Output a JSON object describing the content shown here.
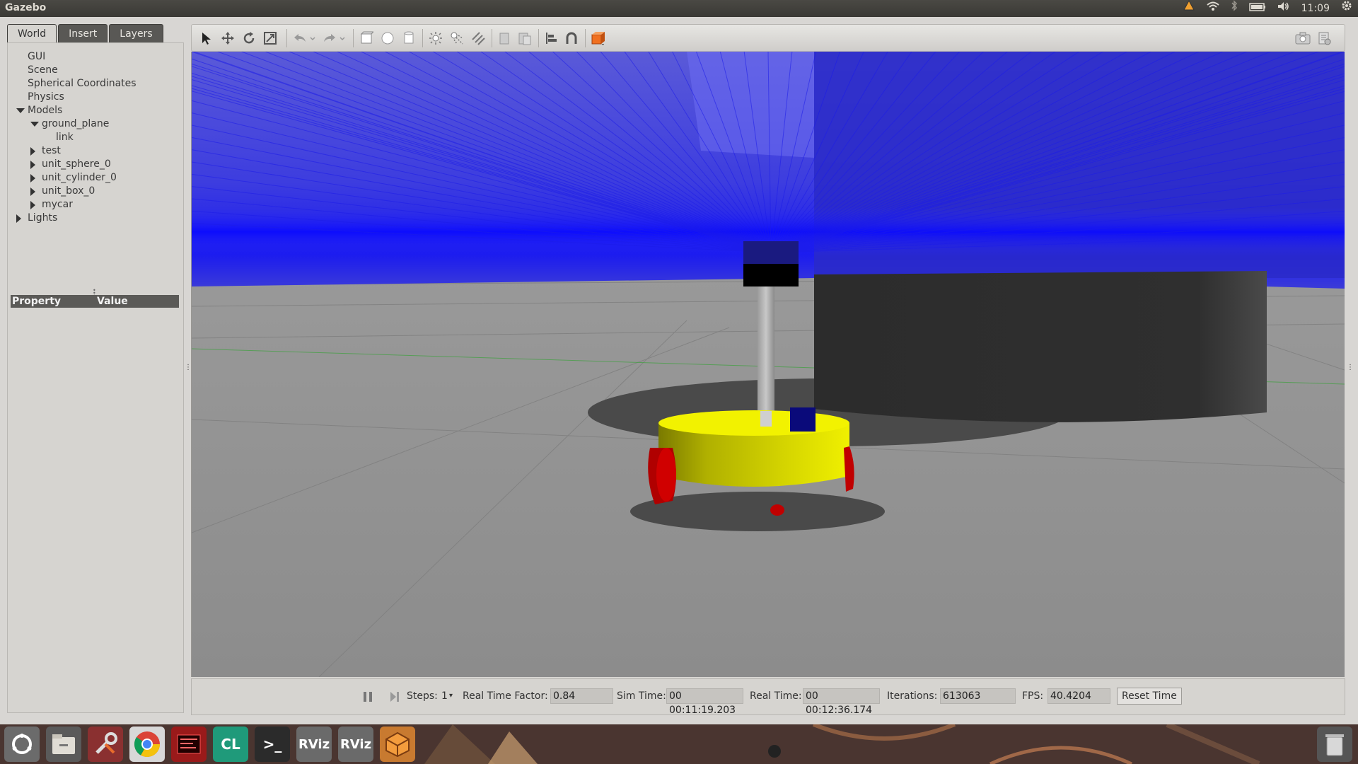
{
  "topbar": {
    "app_title": "Gazebo",
    "clock": "11:09",
    "icons": [
      "ubuntu-one-icon",
      "wifi-icon",
      "bluetooth-icon",
      "battery-icon",
      "volume-icon",
      "power-gear-icon"
    ]
  },
  "left_panel": {
    "tabs": [
      {
        "label": "World",
        "active": true
      },
      {
        "label": "Insert",
        "active": false
      },
      {
        "label": "Layers",
        "active": false
      }
    ],
    "tree": [
      {
        "label": "GUI",
        "level": 1,
        "expander": "none"
      },
      {
        "label": "Scene",
        "level": 1,
        "expander": "none"
      },
      {
        "label": "Spherical Coordinates",
        "level": 1,
        "expander": "none"
      },
      {
        "label": "Physics",
        "level": 1,
        "expander": "none"
      },
      {
        "label": "Models",
        "level": 1,
        "expander": "expanded"
      },
      {
        "label": "ground_plane",
        "level": 2,
        "expander": "expanded"
      },
      {
        "label": "link",
        "level": 3,
        "expander": "none"
      },
      {
        "label": "test",
        "level": 2,
        "expander": "collapsed"
      },
      {
        "label": "unit_sphere_0",
        "level": 2,
        "expander": "collapsed"
      },
      {
        "label": "unit_cylinder_0",
        "level": 2,
        "expander": "collapsed"
      },
      {
        "label": "unit_box_0",
        "level": 2,
        "expander": "collapsed"
      },
      {
        "label": "mycar",
        "level": 2,
        "expander": "collapsed"
      },
      {
        "label": "Lights",
        "level": 1,
        "expander": "collapsed"
      }
    ],
    "property_header": {
      "property": "Property",
      "value": "Value"
    }
  },
  "toolbar": {
    "tools": [
      "select-arrow-icon",
      "translate-icon",
      "rotate-icon",
      "scale-icon",
      "undo-icon",
      "undo-dropdown-icon",
      "redo-icon",
      "redo-dropdown-icon",
      "box-shape-icon",
      "sphere-shape-icon",
      "cylinder-shape-icon",
      "point-light-icon",
      "spot-light-icon",
      "directional-light-icon",
      "copy-icon",
      "paste-icon",
      "align-icon",
      "snap-icon",
      "view-angle-icon"
    ],
    "right_tools": [
      "screenshot-camera-icon",
      "log-recorder-icon"
    ]
  },
  "bottombar": {
    "steps_label": "Steps:",
    "steps_value": "1",
    "rtf_label": "Real Time Factor:",
    "rtf_value": "0.84",
    "sim_time_label": "Sim Time:",
    "sim_time_value": "00 00:11:19.203",
    "real_time_label": "Real Time:",
    "real_time_value": "00 00:12:36.174",
    "iterations_label": "Iterations:",
    "iterations_value": "613063",
    "fps_label": "FPS:",
    "fps_value": "40.4204",
    "reset_label": "Reset Time"
  },
  "dock": {
    "items": [
      {
        "name": "dash-home-icon",
        "label": ""
      },
      {
        "name": "files-icon",
        "label": ""
      },
      {
        "name": "system-settings-icon",
        "label": ""
      },
      {
        "name": "chrome-icon",
        "label": ""
      },
      {
        "name": "ide-red-icon",
        "label": ""
      },
      {
        "name": "clion-icon",
        "label": "CL"
      },
      {
        "name": "terminal-icon",
        "label": ">_"
      },
      {
        "name": "rviz-icon-1",
        "label": "RViz"
      },
      {
        "name": "rviz-icon-2",
        "label": "RViz"
      },
      {
        "name": "gazebo-icon",
        "label": ""
      },
      {
        "name": "trash-icon",
        "label": ""
      }
    ]
  },
  "colors": {
    "laser": "#2020e0",
    "robot_body": "#e6e600",
    "wheels": "#cc0000",
    "obstacle": "#2b2b2b",
    "ground": "#8f8f8f"
  }
}
